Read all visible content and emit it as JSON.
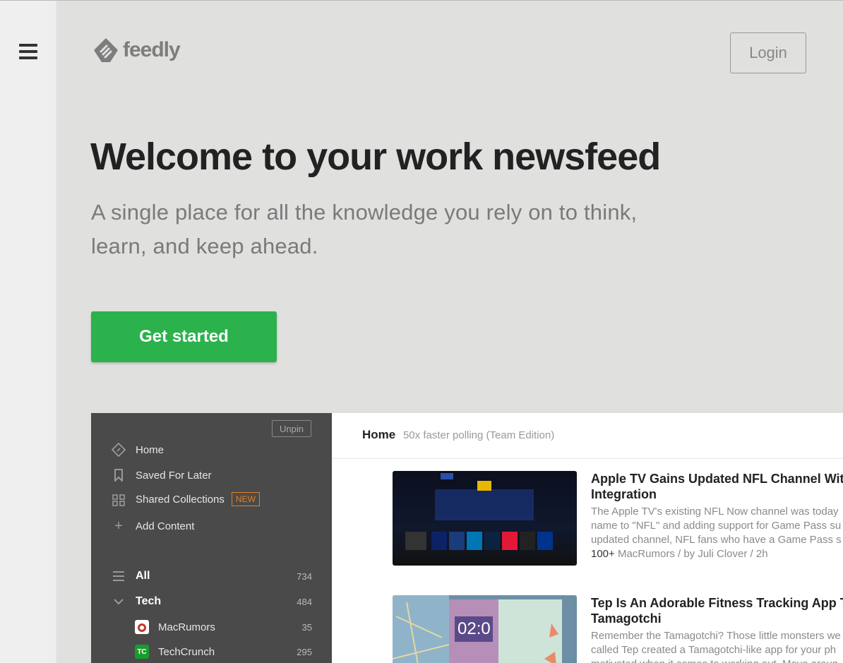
{
  "brand": {
    "name": "feedly"
  },
  "header": {
    "login_label": "Login",
    "menu_icon": "hamburger-icon"
  },
  "hero": {
    "title": "Welcome to your work newsfeed",
    "subtitle": "A single place for all the knowledge you rely on to think, learn, and keep ahead.",
    "cta_label": "Get started"
  },
  "preview": {
    "sidebar": {
      "unpin_label": "Unpin",
      "items": [
        {
          "label": "Home",
          "icon": "feedly-home-icon"
        },
        {
          "label": "Saved For Later",
          "icon": "bookmark-icon"
        },
        {
          "label": "Shared Collections",
          "icon": "collections-icon",
          "badge": "NEW"
        },
        {
          "label": "Add Content",
          "icon": "plus-icon"
        }
      ],
      "feeds": [
        {
          "label": "All",
          "count": "734",
          "icon": "list-icon"
        },
        {
          "label": "Tech",
          "count": "484",
          "icon": "chevron-down-icon"
        },
        {
          "label": "MacRumors",
          "count": "35",
          "icon": "macrumors-icon"
        },
        {
          "label": "TechCrunch",
          "count": "295",
          "icon": "techcrunch-icon"
        }
      ]
    },
    "main": {
      "title": "Home",
      "subtitle": "50x faster polling (Team Edition)",
      "articles": [
        {
          "title_line1": "Apple TV Gains Updated NFL Channel Wit",
          "title_line2": "Integration",
          "body": "The Apple TV's existing NFL Now channel was today name to \"NFL\" and adding support for Game Pass su updated channel, NFL fans who have a Game Pass s",
          "meta_count": "100+",
          "meta_source": "MacRumors / by Juli Clover / 2h"
        },
        {
          "title_line1": "Tep Is An Adorable Fitness Tracking App T",
          "title_line2": "Tamagotchi",
          "body": "Remember the Tamagotchi? Those little monsters we called Tep created a Tamagotchi-like app for your ph motivated when it comes to working out. Move aroun"
        }
      ]
    }
  },
  "colors": {
    "accent_green": "#2bb24c",
    "new_badge": "#e67e22",
    "sidebar_bg": "#4a4a4a"
  }
}
